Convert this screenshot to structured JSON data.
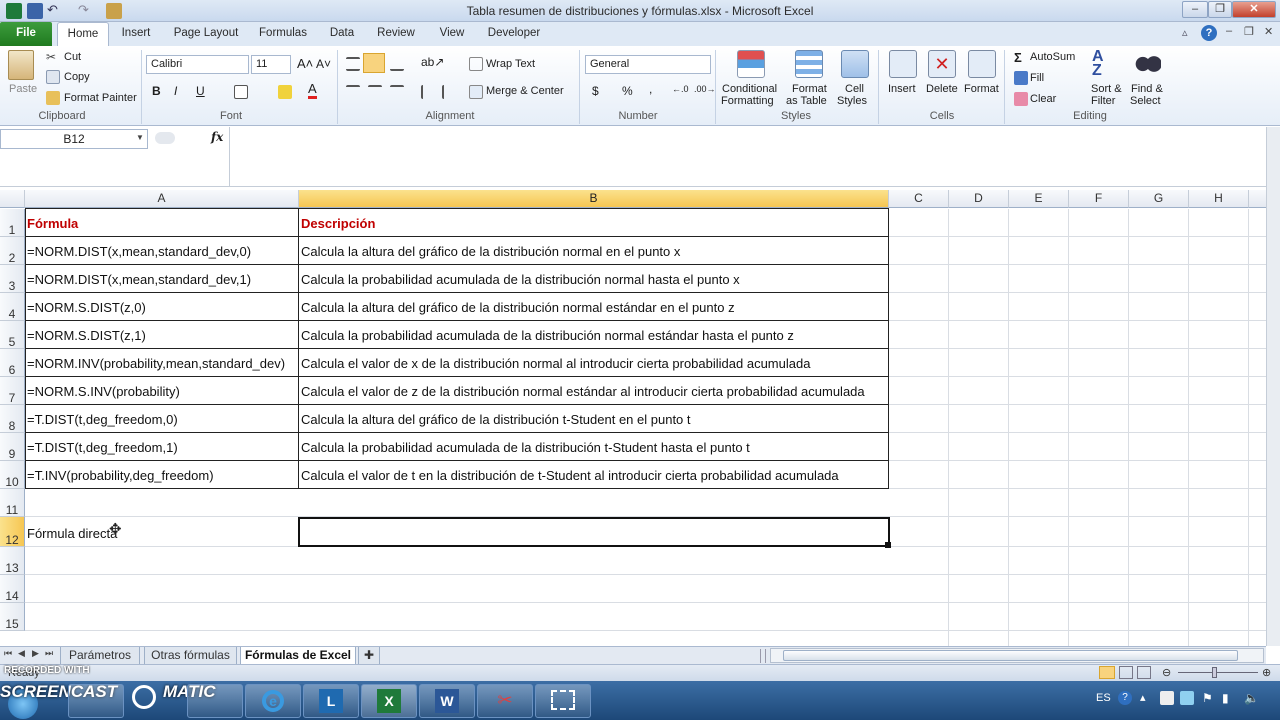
{
  "window": {
    "title": "Tabla resumen de distribuciones y fórmulas.xlsx  -  Microsoft Excel"
  },
  "ribbon_tabs": [
    "File",
    "Home",
    "Insert",
    "Page Layout",
    "Formulas",
    "Data",
    "Review",
    "View",
    "Developer"
  ],
  "clipboard": {
    "paste": "Paste",
    "cut": "Cut",
    "copy": "Copy",
    "format_painter": "Format Painter",
    "label": "Clipboard"
  },
  "font": {
    "name": "Calibri",
    "size": "11",
    "label": "Font",
    "bold": "B",
    "italic": "I",
    "underline": "U"
  },
  "alignment": {
    "wrap": "Wrap Text",
    "merge": "Merge & Center",
    "label": "Alignment"
  },
  "number": {
    "format": "General",
    "currency": "$",
    "percent": "%",
    "comma": ",",
    "label": "Number"
  },
  "styles": {
    "conditional": "Conditional",
    "conditional2": "Formatting",
    "format_table": "Format",
    "format_table2": "as Table",
    "cell_styles": "Cell",
    "cell_styles2": "Styles",
    "label": "Styles"
  },
  "cells": {
    "insert": "Insert",
    "delete": "Delete",
    "format": "Format",
    "label": "Cells"
  },
  "editing": {
    "autosum": "AutoSum",
    "fill": "Fill",
    "clear": "Clear",
    "sort": "Sort &",
    "sort2": "Filter",
    "find": "Find &",
    "find2": "Select",
    "label": "Editing"
  },
  "formula_bar": {
    "name_box": "B12",
    "fx": "fx",
    "content": ""
  },
  "columns": [
    "A",
    "B",
    "C",
    "D",
    "E",
    "F",
    "G",
    "H"
  ],
  "rows": [
    {
      "n": "1",
      "a": "Fórmula",
      "b": "Descripción"
    },
    {
      "n": "2",
      "a": "=NORM.DIST(x,mean,standard_dev,0)",
      "b": "Calcula la altura del gráfico de la distribución normal en el punto x"
    },
    {
      "n": "3",
      "a": "=NORM.DIST(x,mean,standard_dev,1)",
      "b": "Calcula la probabilidad acumulada de la distribución normal hasta el punto x"
    },
    {
      "n": "4",
      "a": "=NORM.S.DIST(z,0)",
      "b": "Calcula la altura del gráfico de la distribución normal estándar en el punto z"
    },
    {
      "n": "5",
      "a": "=NORM.S.DIST(z,1)",
      "b": "Calcula la probabilidad acumulada de la distribución normal estándar hasta el punto z"
    },
    {
      "n": "6",
      "a": "=NORM.INV(probability,mean,standard_dev)",
      "b": "Calcula el valor de x de la distribución normal al introducir cierta probabilidad acumulada"
    },
    {
      "n": "7",
      "a": "=NORM.S.INV(probability)",
      "b": "Calcula el valor de z de la distribución normal estándar al introducir cierta probabilidad acumulada"
    },
    {
      "n": "8",
      "a": "=T.DIST(t,deg_freedom,0)",
      "b": "Calcula la altura del gráfico de la distribución t-Student en el punto t"
    },
    {
      "n": "9",
      "a": "=T.DIST(t,deg_freedom,1)",
      "b": "Calcula la probabilidad acumulada de la distribución t-Student hasta el punto t"
    },
    {
      "n": "10",
      "a": "=T.INV(probability,deg_freedom)",
      "b": "Calcula el valor de t en la distribución de t-Student al introducir cierta probabilidad acumulada"
    },
    {
      "n": "11",
      "a": "",
      "b": ""
    },
    {
      "n": "12",
      "a": "Fórmula directa",
      "b": ""
    },
    {
      "n": "13",
      "a": "",
      "b": ""
    },
    {
      "n": "14",
      "a": "",
      "b": ""
    },
    {
      "n": "15",
      "a": "",
      "b": ""
    }
  ],
  "sheet_tabs": [
    "Parámetros",
    "Otras fórmulas",
    "Fórmulas de Excel"
  ],
  "active_sheet": "Fórmulas de Excel",
  "status": {
    "ready": "Ready"
  },
  "watermark": {
    "line1": "RECORDED WITH",
    "line2": "SCREENCAST",
    "line3": "MATIC"
  },
  "tray": {
    "lang": "ES"
  },
  "colors": {
    "header_red": "#c00000",
    "excel_green": "#1f7a1f",
    "selected_header": "#f6c652"
  }
}
